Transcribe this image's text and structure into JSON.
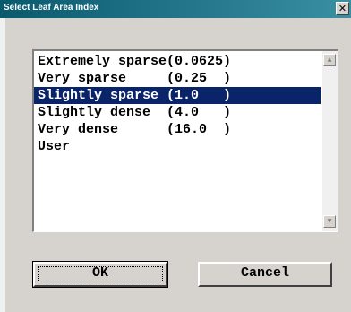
{
  "window": {
    "title": "Select Leaf Area Index",
    "close_glyph": "✕"
  },
  "listbox": {
    "items": [
      {
        "label": "Extremely sparse(0.0625)",
        "selected": false
      },
      {
        "label": "Very sparse     (0.25  )",
        "selected": false
      },
      {
        "label": "Slightly sparse (1.0   )",
        "selected": true
      },
      {
        "label": "Slightly dense  (4.0   )",
        "selected": false
      },
      {
        "label": "Very dense      (16.0  )",
        "selected": false
      },
      {
        "label": "User",
        "selected": false
      }
    ],
    "scroll_up_glyph": "▲",
    "scroll_down_glyph": "▼"
  },
  "buttons": {
    "ok_label": "OK",
    "cancel_label": "Cancel"
  },
  "colors": {
    "selection": "#0a246a",
    "title_bar": "#0a5a6e"
  }
}
